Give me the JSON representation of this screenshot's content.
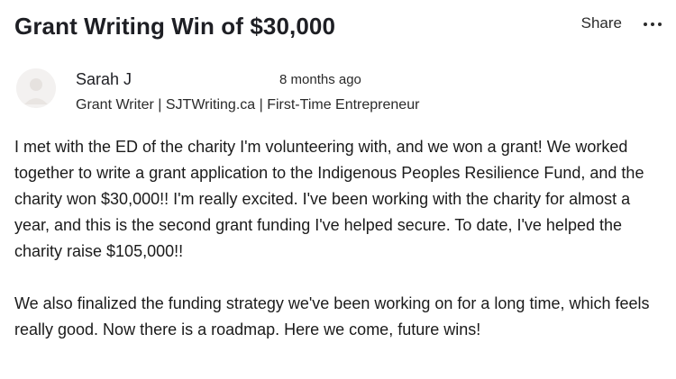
{
  "post": {
    "title": "Grant Writing Win of $30,000",
    "share_label": "Share",
    "more_icon": "more-horizontal-icon"
  },
  "author": {
    "name": "Sarah J",
    "time": "8 months ago",
    "byline": "Grant Writer | SJTWriting.ca | First-Time Entrepreneur"
  },
  "body": {
    "paragraphs": [
      "I met with the ED of the charity I'm volunteering with, and we won a grant! We worked together to write a grant application to the Indigenous Peoples Resilience Fund, and the charity won $30,000!! I'm really excited. I've been working with the charity for almost a year, and this is the second grant funding I've helped secure. To date, I've helped the charity raise $105,000!!",
      "We also finalized the funding strategy we've been working on for a long time, which feels really good. Now there is a roadmap. Here we come, future wins!"
    ]
  }
}
